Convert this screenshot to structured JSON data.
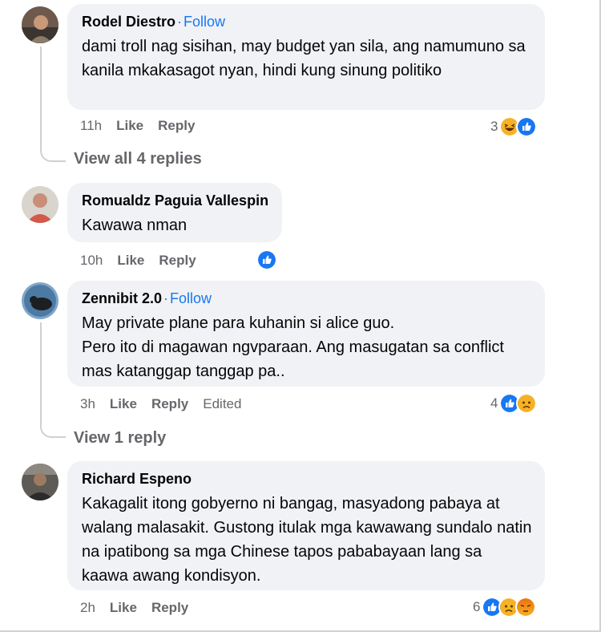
{
  "follow_label": "Follow",
  "like_label": "Like",
  "reply_label": "Reply",
  "comments": [
    {
      "author": "Rodel Diestro",
      "text": "dami troll nag sisihan, may budget yan sila, ang namumuno sa kanila mkakasagot nyan, hindi kung sinung politiko",
      "time": "11h",
      "reaction_count": "3",
      "reactions": [
        "haha",
        "like"
      ],
      "view_replies": "View all 4 replies"
    },
    {
      "author": "Romualdz Paguia Vallespin",
      "text": "Kawawa nman",
      "time": "10h",
      "reactions": [
        "like"
      ]
    },
    {
      "author": "Zennibit 2.0",
      "text": "May private plane para kuhanin si alice guo.\nPero ito di magawan ngvparaan. Ang masugatan sa conflict mas katanggap tanggap pa..",
      "time": "3h",
      "edited": "Edited",
      "reaction_count": "4",
      "reactions": [
        "like",
        "sad"
      ],
      "view_replies": "View 1 reply"
    },
    {
      "author": "Richard Espeno",
      "text": "Kakagalit itong gobyerno ni bangag, masyadong pabaya at walang malasakit. Gustong itulak mga kawawang sundalo natin na ipatibong sa mga Chinese tapos pababayaan lang sa kaawa awang kondisyon.",
      "time": "2h",
      "reaction_count": "6",
      "reactions": [
        "like",
        "sad",
        "angry"
      ]
    }
  ]
}
